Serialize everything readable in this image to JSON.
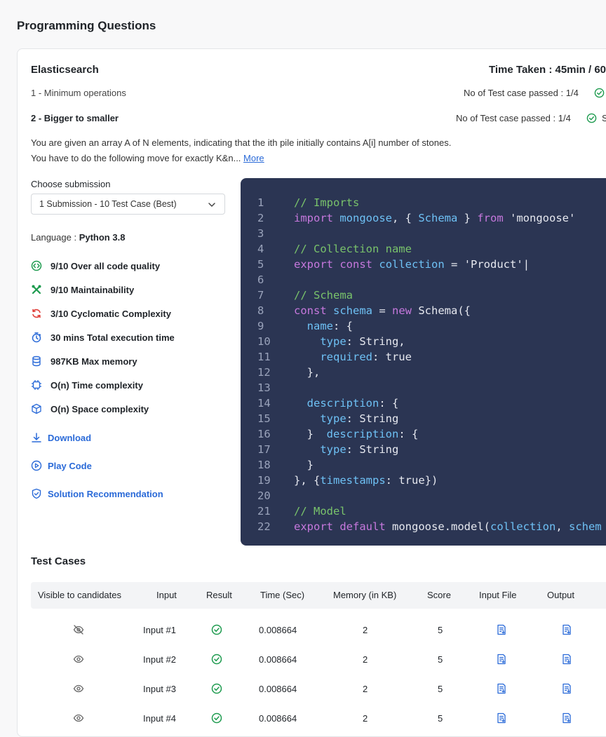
{
  "page_title": "Programming Questions",
  "question": {
    "title": "Elasticsearch",
    "time_taken": "Time Taken : 45min / 60"
  },
  "questions": [
    {
      "label": "1 - Minimum operations",
      "passed": "No of Test case passed : 1/4"
    },
    {
      "label": "2 - Bigger to smaller",
      "passed": "No of Test case passed : 1/4",
      "trailing": "S"
    }
  ],
  "description": {
    "line1": "You are given an array A of N elements, indicating that the ith pile initially contains A[i] number of stones.",
    "line2": "You have to do the following move for exactly K&n...",
    "more": "More"
  },
  "submission": {
    "label": "Choose submission",
    "selected": "1 Submission - 10 Test Case (Best)"
  },
  "language": {
    "label": "Language : ",
    "value": "Python 3.8"
  },
  "metrics": [
    {
      "icon": "code-quality-icon",
      "text": "9/10 Over all code quality"
    },
    {
      "icon": "tools-icon",
      "text": "9/10 Maintainability"
    },
    {
      "icon": "cycle-icon",
      "text": "3/10 Cyclomatic Complexity"
    },
    {
      "icon": "stopwatch-icon",
      "text": "30 mins Total execution time"
    },
    {
      "icon": "database-icon",
      "text": "987KB Max memory"
    },
    {
      "icon": "chip-icon",
      "text": "O(n) Time complexity"
    },
    {
      "icon": "cube-icon",
      "text": "O(n) Space complexity"
    }
  ],
  "actions": {
    "download": "Download",
    "play": "Play Code",
    "recommendation": "Solution Recommendation"
  },
  "code": {
    "lines": [
      {
        "n": "1",
        "text": "// Imports"
      },
      {
        "n": "2",
        "text": "import mongoose, { Schema } from 'mongoose'"
      },
      {
        "n": "3",
        "text": ""
      },
      {
        "n": "4",
        "text": "// Collection name"
      },
      {
        "n": "5",
        "text": "export const collection = 'Product'|"
      },
      {
        "n": "6",
        "text": ""
      },
      {
        "n": "7",
        "text": "// Schema"
      },
      {
        "n": "8",
        "text": "const schema = new Schema({"
      },
      {
        "n": "9",
        "text": "  name: {"
      },
      {
        "n": "10",
        "text": "    type: String,"
      },
      {
        "n": "11",
        "text": "    required: true"
      },
      {
        "n": "12",
        "text": "  },"
      },
      {
        "n": "13",
        "text": ""
      },
      {
        "n": "14",
        "text": "  description: {"
      },
      {
        "n": "15",
        "text": "    type: String"
      },
      {
        "n": "16",
        "text": "  }  description: {"
      },
      {
        "n": "17",
        "text": "    type: String"
      },
      {
        "n": "18",
        "text": "  }"
      },
      {
        "n": "19",
        "text": "}, {timestamps: true})"
      },
      {
        "n": "20",
        "text": ""
      },
      {
        "n": "21",
        "text": "// Model"
      },
      {
        "n": "22",
        "text": "export default mongoose.model(collection, schem"
      }
    ]
  },
  "test_cases": {
    "title": "Test Cases",
    "headers": [
      "Visible to candidates",
      "Input",
      "Result",
      "Time (Sec)",
      "Memory (in KB)",
      "Score",
      "Input File",
      "Output"
    ],
    "rows": [
      {
        "visible": "eye-off-icon",
        "input": "Input #1",
        "time": "0.008664",
        "memory": "2",
        "score": "5"
      },
      {
        "visible": "eye-icon",
        "input": "Input #2",
        "time": "0.008664",
        "memory": "2",
        "score": "5"
      },
      {
        "visible": "eye-icon",
        "input": "Input #3",
        "time": "0.008664",
        "memory": "2",
        "score": "5"
      },
      {
        "visible": "eye-icon",
        "input": "Input #4",
        "time": "0.008664",
        "memory": "2",
        "score": "5"
      }
    ]
  },
  "colors": {
    "accent": "#2a6ad8",
    "success": "#1e9b4f",
    "code_bg": "#2b3553"
  }
}
